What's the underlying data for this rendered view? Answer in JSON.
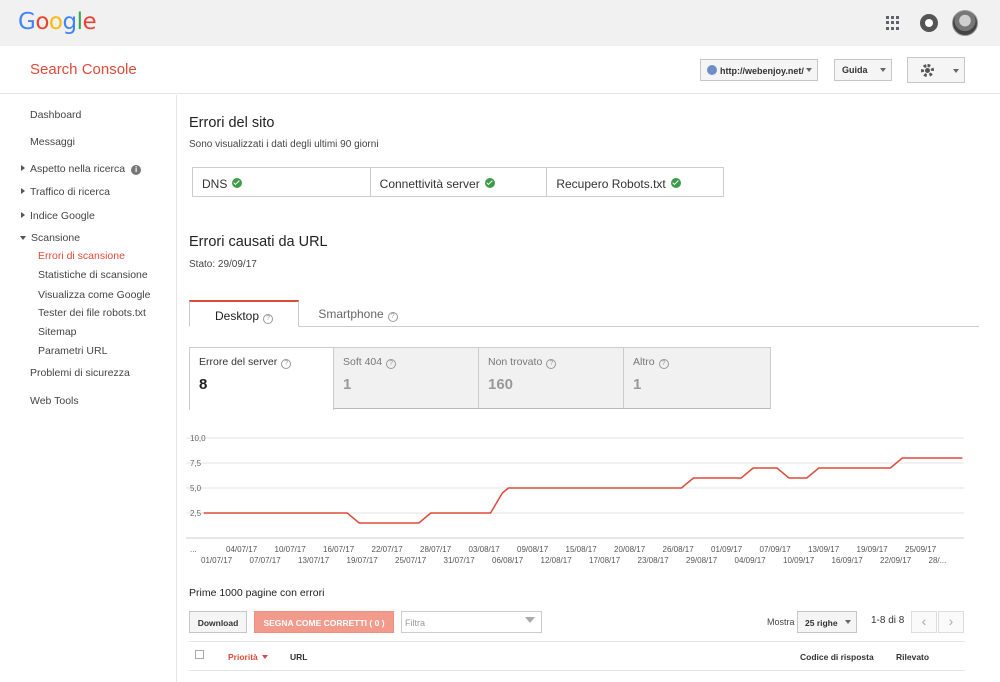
{
  "logo": {
    "letters": [
      "G",
      "o",
      "o",
      "g",
      "l",
      "e"
    ],
    "colors": [
      "#4285f4",
      "#ea4335",
      "#fbbc05",
      "#4285f4",
      "#34a853",
      "#ea4335"
    ]
  },
  "header": {
    "brand": "Search Console",
    "property": "http://webenjoy.net/",
    "help_label": "Guida"
  },
  "sidebar": {
    "items": [
      {
        "label": "Dashboard"
      },
      {
        "label": "Messaggi"
      },
      {
        "label": "Aspetto nella ricerca"
      },
      {
        "label": "Traffico di ricerca"
      },
      {
        "label": "Indice Google"
      },
      {
        "label": "Scansione"
      },
      {
        "label": "Errori di scansione"
      },
      {
        "label": "Statistiche di scansione"
      },
      {
        "label": "Visualizza come Google"
      },
      {
        "label": "Tester dei file robots.txt"
      },
      {
        "label": "Sitemap"
      },
      {
        "label": "Parametri URL"
      },
      {
        "label": "Problemi di sicurezza"
      },
      {
        "label": "Web Tools"
      }
    ]
  },
  "site_errors": {
    "title": "Errori del sito",
    "subtitle": "Sono visualizzati i dati degli ultimi 90 giorni",
    "cells": [
      "DNS",
      "Connettività server",
      "Recupero Robots.txt"
    ]
  },
  "url_errors": {
    "title": "Errori causati da URL",
    "status": "Stato: 29/09/17",
    "tabs": [
      "Desktop",
      "Smartphone"
    ],
    "metrics": [
      {
        "label": "Errore del server",
        "value": "8"
      },
      {
        "label": "Soft 404",
        "value": "1"
      },
      {
        "label": "Non trovato",
        "value": "160"
      },
      {
        "label": "Altro",
        "value": "1"
      }
    ]
  },
  "chart_data": {
    "type": "line",
    "y_ticks": [
      "10,0",
      "7,5",
      "5,0",
      "2,5"
    ],
    "ylim": [
      0,
      10
    ],
    "x_labels_top": [
      "...",
      "04/07/17",
      "10/07/17",
      "16/07/17",
      "22/07/17",
      "28/07/17",
      "03/08/17",
      "09/08/17",
      "15/08/17",
      "20/08/17",
      "26/08/17",
      "01/09/17",
      "07/09/17",
      "13/09/17",
      "19/09/17",
      "25/09/17"
    ],
    "x_labels_bottom": [
      "01/07/17",
      "07/07/17",
      "13/07/17",
      "19/07/17",
      "25/07/17",
      "31/07/17",
      "06/08/17",
      "12/08/17",
      "17/08/17",
      "23/08/17",
      "29/08/17",
      "04/09/17",
      "10/09/17",
      "16/09/17",
      "22/09/17",
      "28/..."
    ],
    "series": [
      {
        "color": "#dd4b39",
        "points": [
          [
            0,
            2.5
          ],
          [
            24,
            2.5
          ],
          [
            26,
            1.5
          ],
          [
            36,
            1.5
          ],
          [
            38,
            2.5
          ],
          [
            48,
            2.5
          ],
          [
            50,
            4.5
          ],
          [
            51,
            5.0
          ],
          [
            80,
            5.0
          ],
          [
            82,
            6.0
          ],
          [
            90,
            6.0
          ],
          [
            92,
            7.0
          ],
          [
            96,
            7.0
          ],
          [
            98,
            6.0
          ],
          [
            101,
            6.0
          ],
          [
            103,
            7.0
          ],
          [
            115,
            7.0
          ],
          [
            117,
            8.0
          ],
          [
            127,
            8.0
          ]
        ]
      }
    ],
    "grid": true
  },
  "table": {
    "title": "Prime 1000 pagine con errori",
    "download_label": "Download",
    "mark_label": "SEGNA COME CORRETTI ( 0 )",
    "filter_placeholder": "Filtra",
    "show_label": "Mostra",
    "rows_select": "25 righe",
    "range": "1-8 di 8",
    "columns": [
      "Priorità",
      "URL",
      "Codice di risposta",
      "Rilevato"
    ]
  }
}
